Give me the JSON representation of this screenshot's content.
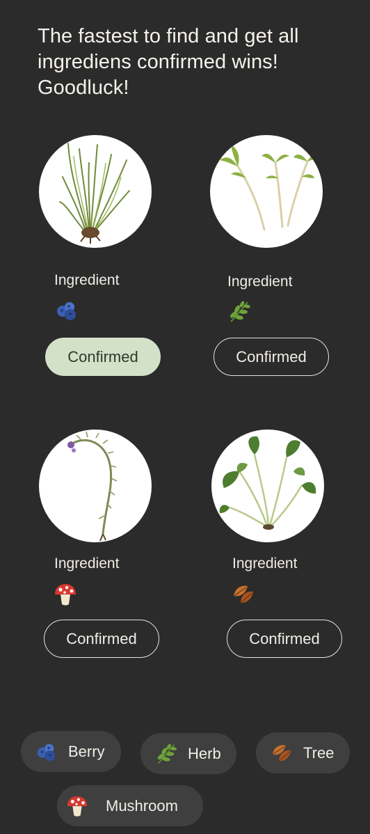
{
  "header": {
    "title": "The fastest to find and get all ingrediens confirmed wins! Goodluck!"
  },
  "cards": [
    {
      "label": "Ingredient",
      "category_icon": "berry-icon",
      "button_label": "Confirmed",
      "confirmed": true,
      "photo": "grass-plant"
    },
    {
      "label": "Ingredient",
      "category_icon": "herb-icon",
      "button_label": "Confirmed",
      "confirmed": false,
      "photo": "sprouts"
    },
    {
      "label": "Ingredient",
      "category_icon": "mushroom-icon",
      "button_label": "Confirmed",
      "confirmed": false,
      "photo": "wild-flower-stem"
    },
    {
      "label": "Ingredient",
      "category_icon": "tree-leaf-icon",
      "button_label": "Confirmed",
      "confirmed": false,
      "photo": "leafy-plant"
    }
  ],
  "legend": [
    {
      "label": "Berry",
      "icon": "berry-icon"
    },
    {
      "label": "Herb",
      "icon": "herb-icon"
    },
    {
      "label": "Tree",
      "icon": "tree-leaf-icon"
    },
    {
      "label": "Mushroom",
      "icon": "mushroom-icon"
    }
  ],
  "colors": {
    "background": "#2b2b2b",
    "confirmed_active": "#d3e1c8",
    "chip_background": "#3f3f3f",
    "text": "#f4f0ea"
  }
}
